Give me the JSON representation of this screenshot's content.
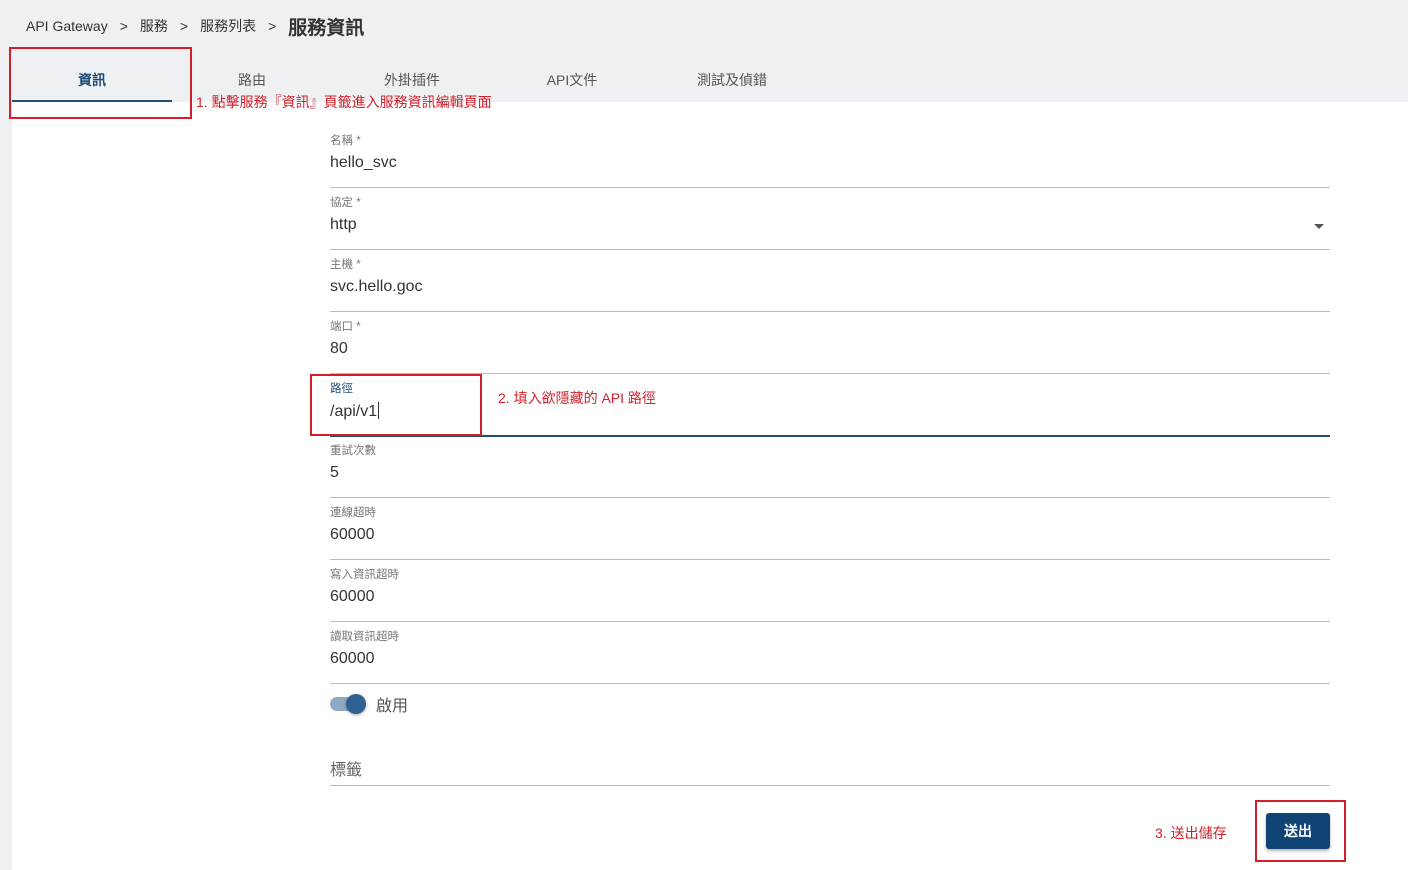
{
  "breadcrumb": {
    "items": [
      "API Gateway",
      "服務",
      "服務列表"
    ],
    "separator": ">",
    "current": "服務資訊"
  },
  "tabs": [
    {
      "label": "資訊",
      "active": true
    },
    {
      "label": "路由",
      "active": false
    },
    {
      "label": "外掛插件",
      "active": false
    },
    {
      "label": "API文件",
      "active": false
    },
    {
      "label": "測試及偵錯",
      "active": false
    }
  ],
  "form": {
    "name": {
      "label": "名稱 *",
      "value": "hello_svc"
    },
    "protocol": {
      "label": "協定 *",
      "value": "http"
    },
    "host": {
      "label": "主機 *",
      "value": "svc.hello.goc"
    },
    "port": {
      "label": "端口 *",
      "value": "80"
    },
    "path": {
      "label": "路徑",
      "value": "/api/v1"
    },
    "retries": {
      "label": "重試次數",
      "value": "5"
    },
    "connect_timeout": {
      "label": "連線超時",
      "value": "60000"
    },
    "write_timeout": {
      "label": "寫入資訊超時",
      "value": "60000"
    },
    "read_timeout": {
      "label": "讀取資訊超時",
      "value": "60000"
    },
    "enabled": {
      "label": "啟用",
      "on": true
    },
    "tags": {
      "placeholder": "標籤"
    },
    "submit_label": "送出"
  },
  "annotations": {
    "step1": "1. 點擊服務『資訊』頁籤進入服務資訊編輯頁面",
    "step2": "2. 填入欲隱藏的 API 路徑",
    "step3": "3. 送出儲存"
  },
  "colors": {
    "accent": "#1f4e79",
    "button": "#0f4374",
    "annotation": "#d21f2a",
    "toggle_track": "#8fa9c4",
    "toggle_thumb": "#2e6092"
  }
}
